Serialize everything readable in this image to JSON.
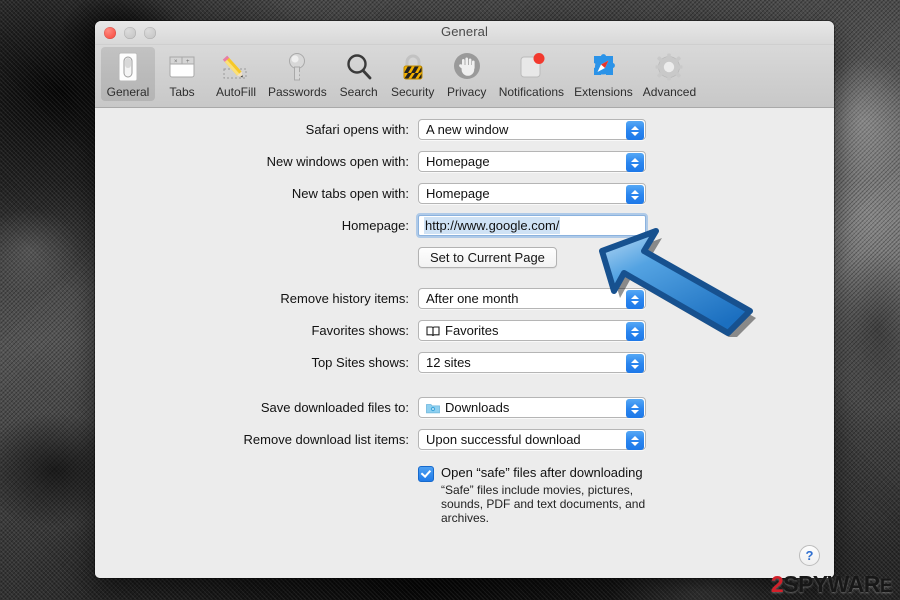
{
  "window": {
    "title": "General",
    "traffic_lights": [
      {
        "name": "close",
        "color": "#f9574c"
      },
      {
        "name": "minimize",
        "color": "#c9c9c9"
      },
      {
        "name": "zoom",
        "color": "#c9c9c9"
      }
    ]
  },
  "toolbar": {
    "selected": "General",
    "items": [
      {
        "label": "General",
        "icon": "light-switch-icon"
      },
      {
        "label": "Tabs",
        "icon": "tabs-icon"
      },
      {
        "label": "AutoFill",
        "icon": "pencil-icon"
      },
      {
        "label": "Passwords",
        "icon": "key-icon"
      },
      {
        "label": "Search",
        "icon": "magnifier-icon"
      },
      {
        "label": "Security",
        "icon": "padlock-icon"
      },
      {
        "label": "Privacy",
        "icon": "hand-icon"
      },
      {
        "label": "Notifications",
        "icon": "notification-badge-icon"
      },
      {
        "label": "Extensions",
        "icon": "puzzle-compass-icon"
      },
      {
        "label": "Advanced",
        "icon": "gear-icon"
      }
    ]
  },
  "settings": {
    "rows": [
      {
        "label": "Safari opens with:",
        "value": "A new window",
        "control": "popup",
        "name": "safari-opens-with"
      },
      {
        "label": "New windows open with:",
        "value": "Homepage",
        "control": "popup",
        "name": "new-windows-open-with"
      },
      {
        "label": "New tabs open with:",
        "value": "Homepage",
        "control": "popup",
        "name": "new-tabs-open-with"
      }
    ],
    "homepage": {
      "label": "Homepage:",
      "value": "http://www.google.com/",
      "selected": true,
      "button_label": "Set to Current Page"
    },
    "rows2": [
      {
        "label": "Remove history items:",
        "value": "After one month",
        "control": "popup",
        "name": "remove-history-items"
      },
      {
        "label": "Favorites shows:",
        "value": "Favorites",
        "icon": "book-icon",
        "control": "popup",
        "name": "favorites-shows"
      },
      {
        "label": "Top Sites shows:",
        "value": "12 sites",
        "control": "popup",
        "name": "top-sites-shows"
      }
    ],
    "rows3": [
      {
        "label": "Save downloaded files to:",
        "value": "Downloads",
        "icon": "folder-icon",
        "control": "popup",
        "name": "save-downloaded-files-to"
      },
      {
        "label": "Remove download list items:",
        "value": "Upon successful download",
        "control": "popup",
        "name": "remove-download-list-items"
      }
    ],
    "safe_files": {
      "checked": true,
      "title": "Open “safe” files after downloading",
      "description": "“Safe” files include movies, pictures, sounds, PDF and text documents, and archives."
    },
    "help_label": "?"
  },
  "watermark": {
    "prefix": "2",
    "text": "SPYWAR",
    "suffix": "E",
    "red": "#d3202a",
    "dark": "#171717"
  },
  "colors": {
    "accent_blue": "#2b86ef",
    "pointer_fill": "#2f8de0",
    "pointer_stroke": "#17518f",
    "window_bg": "#ececec"
  }
}
